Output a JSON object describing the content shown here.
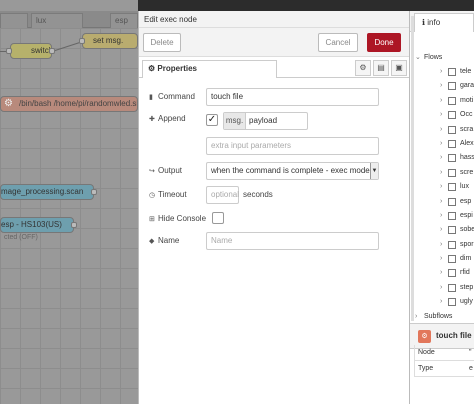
{
  "workspace": {
    "tabs": [
      "lux",
      "esp"
    ],
    "nodes": {
      "switch_label": "switch",
      "set_label": "set msg.",
      "exec_label": "/bin/bash /home/pi/randomwled.sh",
      "scan_label": "mage_processing.scan",
      "hs_label": "esp - HS103(US)",
      "hs_status": "cted (OFF)"
    }
  },
  "editor": {
    "title": "Edit exec node",
    "delete_label": "Delete",
    "cancel_label": "Cancel",
    "done_label": "Done",
    "properties_tab": "Properties",
    "command_label": "Command",
    "command_value": "touch file",
    "append_label": "Append",
    "append_checked": "✓",
    "append_prefix": "msg.",
    "append_value": "payload",
    "extra_placeholder": "extra input parameters",
    "output_label": "Output",
    "output_value": "when the command is complete - exec mode",
    "timeout_label": "Timeout",
    "timeout_placeholder": "optional",
    "timeout_suffix": "seconds",
    "hideconsole_label": "Hide Console",
    "name_label": "Name",
    "name_placeholder": "Name"
  },
  "sidebar": {
    "tab_label": "info",
    "flows_label": "Flows",
    "flows": [
      "tele",
      "gara",
      "moti",
      "Occ",
      "scra",
      "Alex",
      "hass",
      "scre",
      "lux",
      "esp",
      "espi",
      "sobe",
      "spor",
      "dim",
      "rfid",
      "step",
      "ugly"
    ],
    "subflows_label": "Subflows",
    "node_name": "touch file",
    "table": [
      {
        "key": "Node",
        "val": "\""
      },
      {
        "key": "Type",
        "val": "e"
      }
    ]
  },
  "colors": {
    "done": "#ad1625",
    "exec_node": "#e2775b",
    "workspace_dim": "#999999"
  }
}
